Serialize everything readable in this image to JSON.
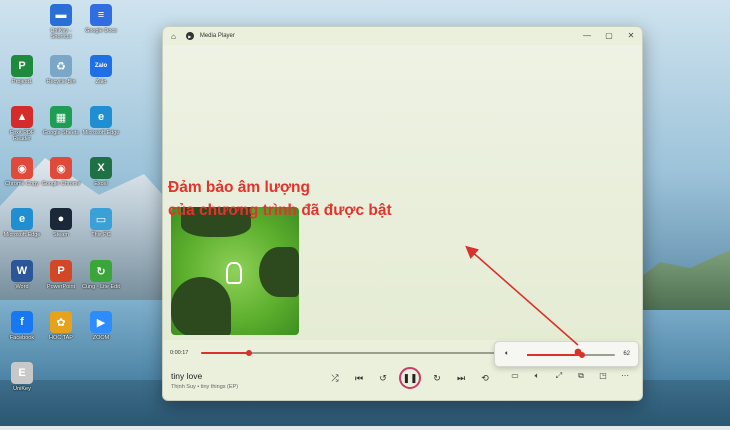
{
  "desktop": {
    "icons": [
      {
        "label": "UniKey - Shortcut",
        "color": "#2a6fd6",
        "glyph": "▬"
      },
      {
        "label": "Google Docs",
        "color": "#2f6de1",
        "glyph": "≡"
      },
      {
        "label": "Project1",
        "color": "#1e8a3c",
        "glyph": "P"
      },
      {
        "label": "Recycle Bin",
        "color": "#7aa7c7",
        "glyph": "♻"
      },
      {
        "label": "Zalo",
        "color": "#1f6fe5",
        "glyph": "Zalo"
      },
      {
        "label": "Foxit PDF Reader",
        "color": "#d62b2b",
        "glyph": "▲"
      },
      {
        "label": "Google Sheets",
        "color": "#1f9d55",
        "glyph": "▦"
      },
      {
        "label": "Microsoft Edge",
        "color": "#1f8fd1",
        "glyph": "e"
      },
      {
        "label": "Chrome Copy",
        "color": "#e04a3a",
        "glyph": "◉"
      },
      {
        "label": "Google Chrome",
        "color": "#e04a3a",
        "glyph": "◉"
      },
      {
        "label": "Excel",
        "color": "#1e7145",
        "glyph": "X"
      },
      {
        "label": "Microsoft Edge",
        "color": "#1f8fd1",
        "glyph": "e"
      },
      {
        "label": "Steam",
        "color": "#1b2838",
        "glyph": "●"
      },
      {
        "label": "This PC",
        "color": "#3aa0d8",
        "glyph": "▭"
      },
      {
        "label": "Word",
        "color": "#2b579a",
        "glyph": "W"
      },
      {
        "label": "PowerPoint",
        "color": "#d24726",
        "glyph": "P"
      },
      {
        "label": "Cung - Lite Edit",
        "color": "#3aa63a",
        "glyph": "↻"
      },
      {
        "label": "Facebook",
        "color": "#1877f2",
        "glyph": "f"
      },
      {
        "label": "HOC TAP",
        "color": "#e6a21a",
        "glyph": "✿"
      },
      {
        "label": "ZOOM",
        "color": "#2d8cff",
        "glyph": "▶"
      },
      {
        "label": "UniKey",
        "color": "#c8c8c8",
        "glyph": "E"
      }
    ]
  },
  "window": {
    "title": "Media Player",
    "home_icon": "home-icon",
    "controls": {
      "minimize": "—",
      "maximize": "▢",
      "close": "✕"
    }
  },
  "annotation": {
    "line1": "Đảm bảo âm lượng",
    "line2": "của chương trình đã được bật",
    "color": "#e5322d"
  },
  "player": {
    "elapsed": "0:00:17",
    "progress": 0.16,
    "volume_value": "62",
    "volume_level": 0.62,
    "song_title": "tiny love",
    "song_subtitle": "Thịnh Suy • tiny things (EP)",
    "accent": "#d8322a"
  }
}
